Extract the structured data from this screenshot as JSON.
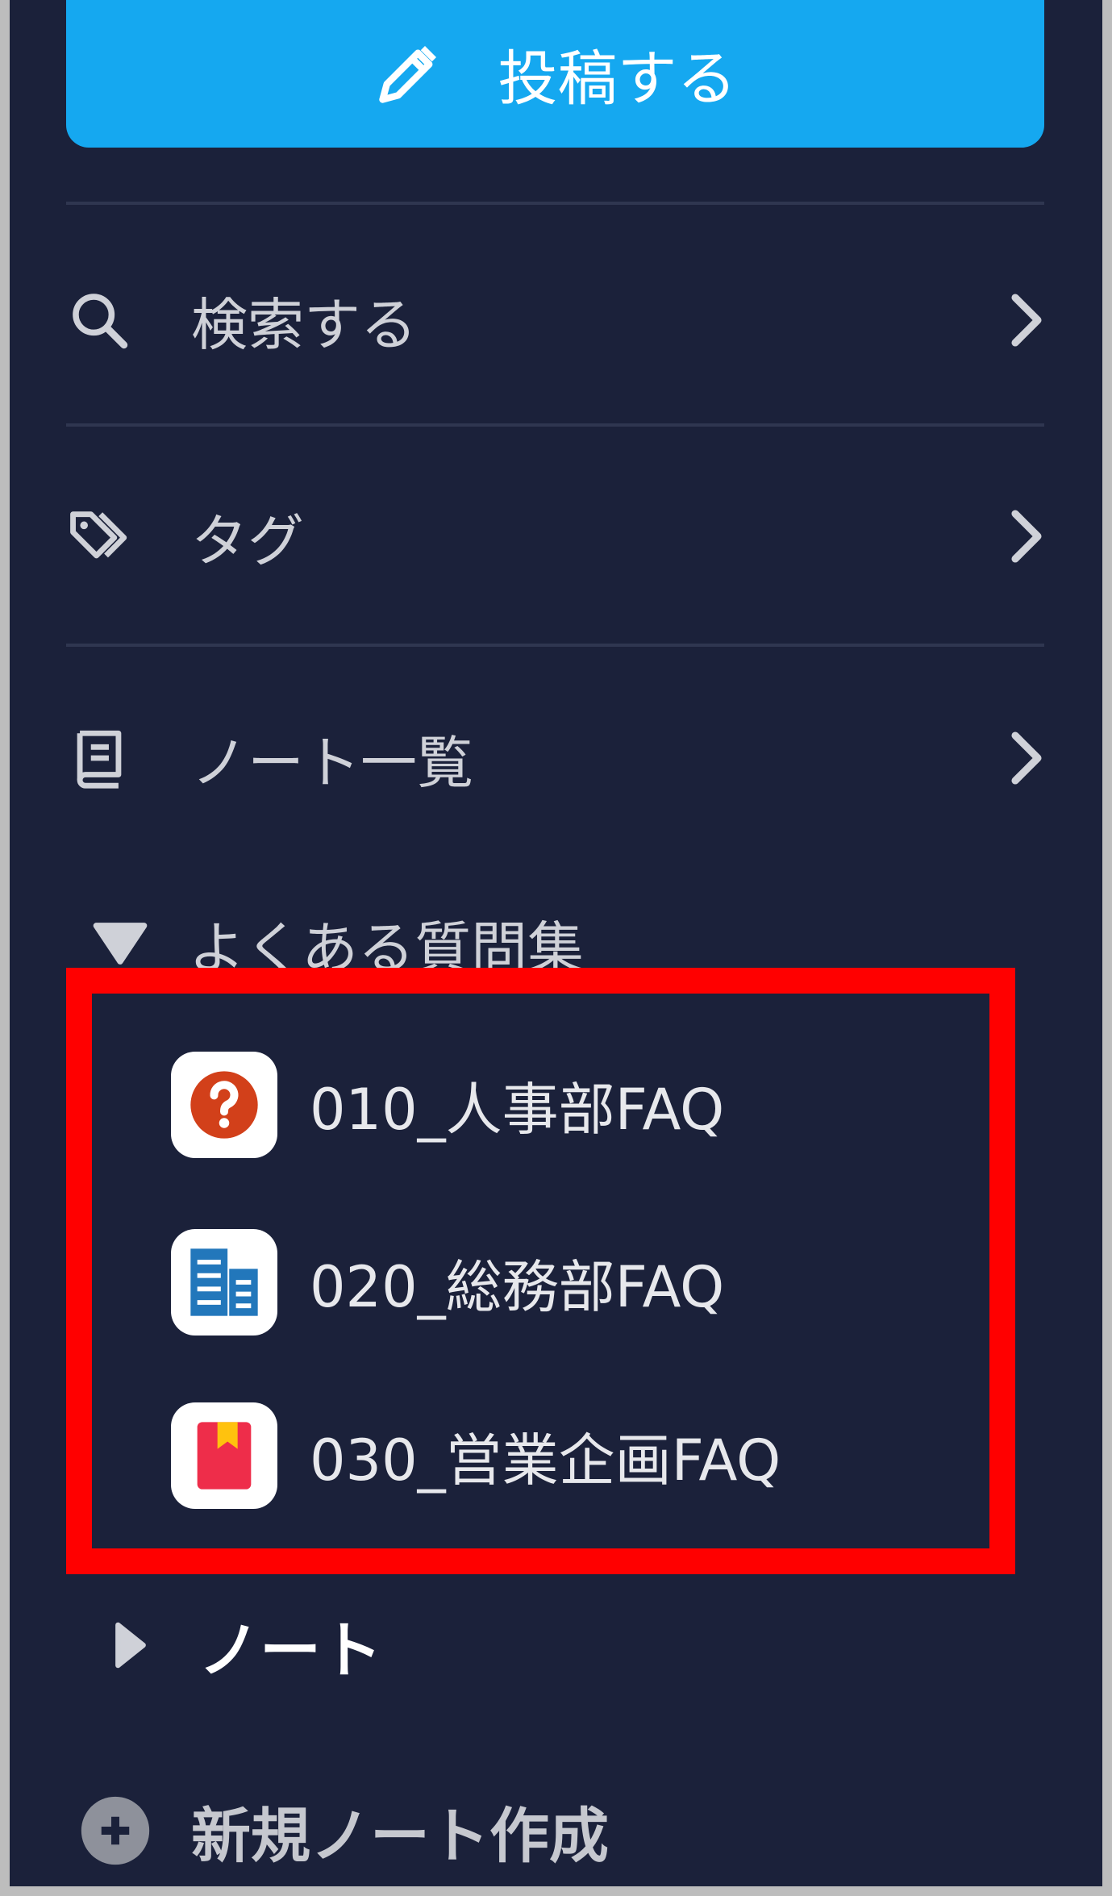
{
  "post_button": {
    "label": "投稿する",
    "icon": "pencil-icon"
  },
  "menu": [
    {
      "label": "検索する",
      "icon": "search-icon"
    },
    {
      "label": "タグ",
      "icon": "tag-icon"
    },
    {
      "label": "ノート一覧",
      "icon": "notebook-icon"
    }
  ],
  "faq_section": {
    "label": "よくある質問集",
    "expanded": true,
    "items": [
      {
        "label": "010_人事部FAQ",
        "icon": "question-icon",
        "icon_color": "#d2401a"
      },
      {
        "label": "020_総務部FAQ",
        "icon": "building-icon",
        "icon_color": "#2277bb"
      },
      {
        "label": "030_営業企画FAQ",
        "icon": "bookmark-book-icon",
        "icon_color": "#ee2d4a"
      }
    ]
  },
  "note_section": {
    "label": "ノート",
    "expanded": false
  },
  "new_note": {
    "label": "新規ノート作成",
    "icon": "plus-circle-icon"
  },
  "colors": {
    "sidebar_bg": "#1b213a",
    "accent": "#15a8f0",
    "highlight": "#ff0000"
  }
}
